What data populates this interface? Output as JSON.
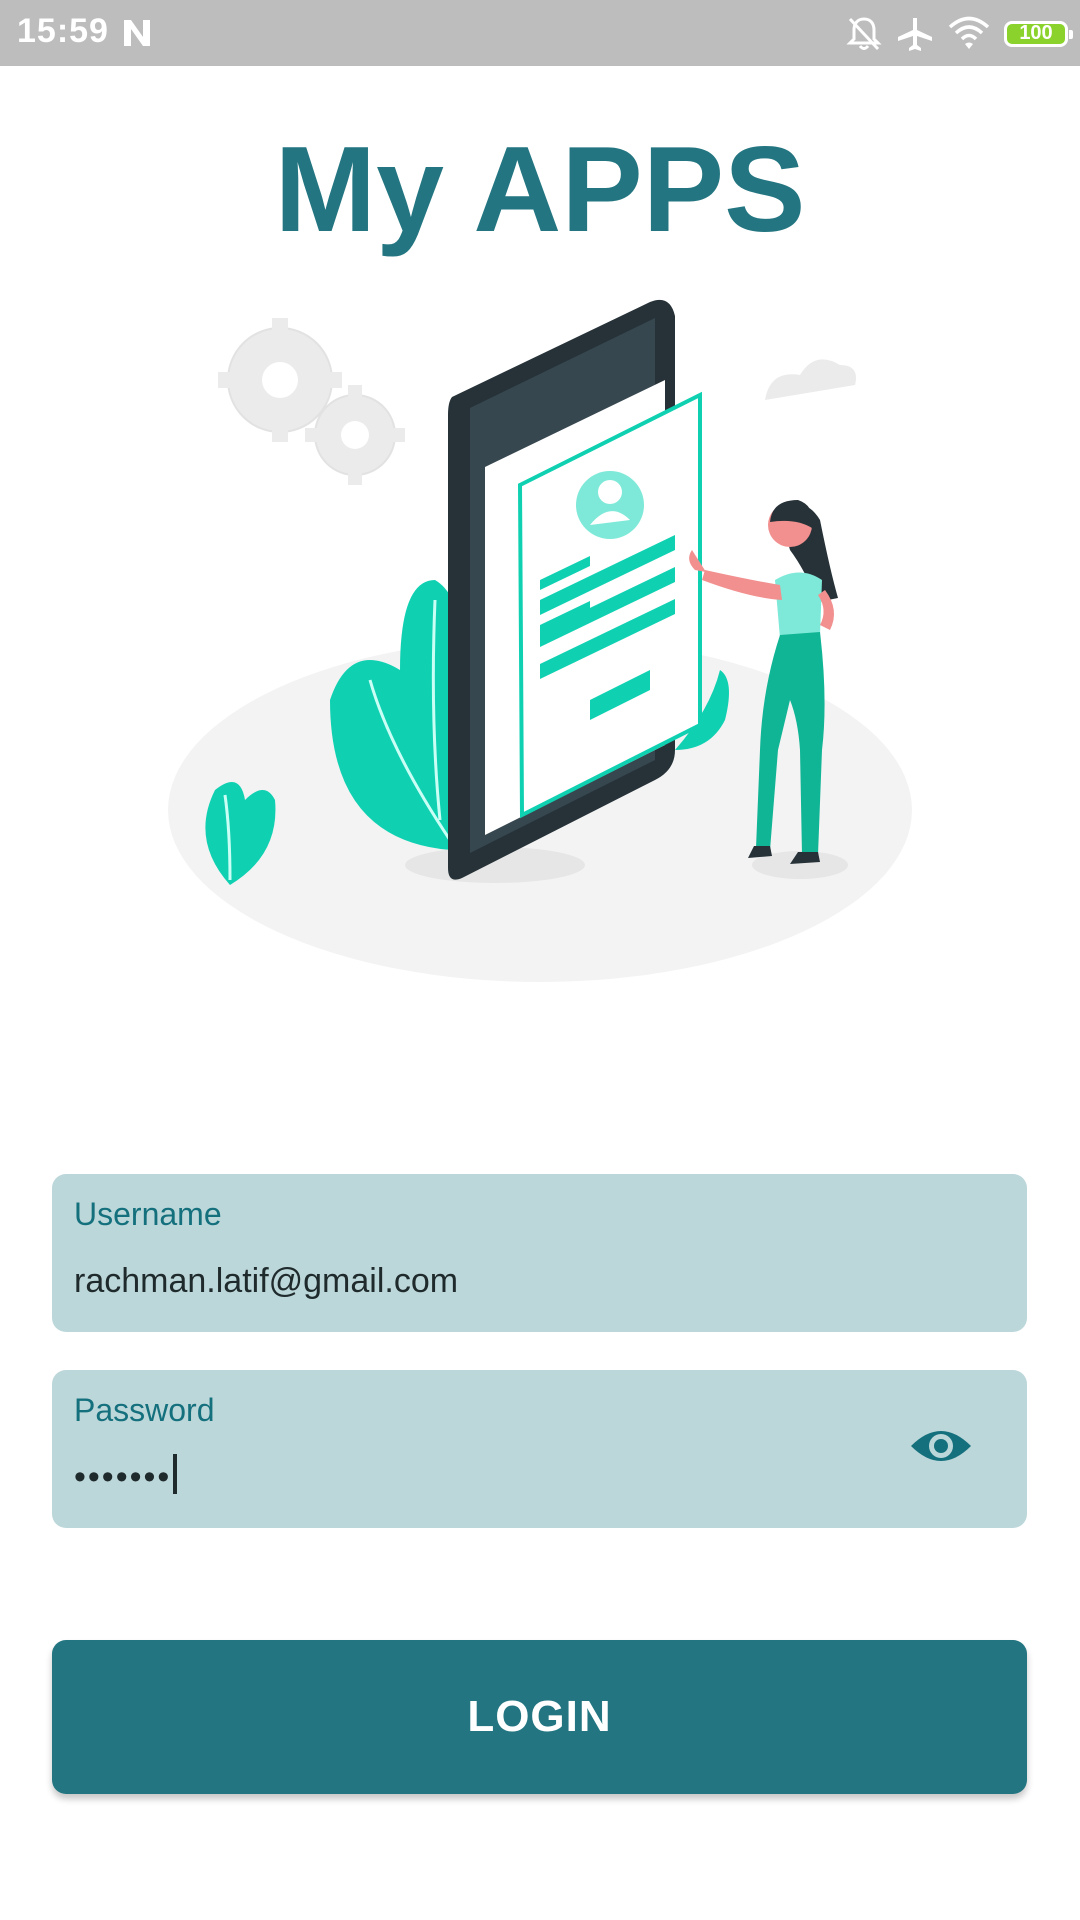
{
  "status_bar": {
    "time": "15:59",
    "battery_level": "100",
    "icons": [
      "notification-n-icon",
      "notifications-off-icon",
      "airplane-mode-icon",
      "wifi-icon",
      "battery-icon"
    ]
  },
  "app": {
    "title": "My APPS"
  },
  "illustration": {
    "icon": "login-illustration",
    "accent_color": "#0fd1b2"
  },
  "form": {
    "username": {
      "label": "Username",
      "value": "rachman.latif@gmail.com"
    },
    "password": {
      "label": "Password",
      "value": "•••••••",
      "toggle_icon": "eye-icon"
    },
    "login_label": "LOGIN"
  },
  "colors": {
    "primary": "#237681",
    "field_background": "#bcd7da",
    "label": "#15707d",
    "status_bar": "#bdbdbd"
  }
}
